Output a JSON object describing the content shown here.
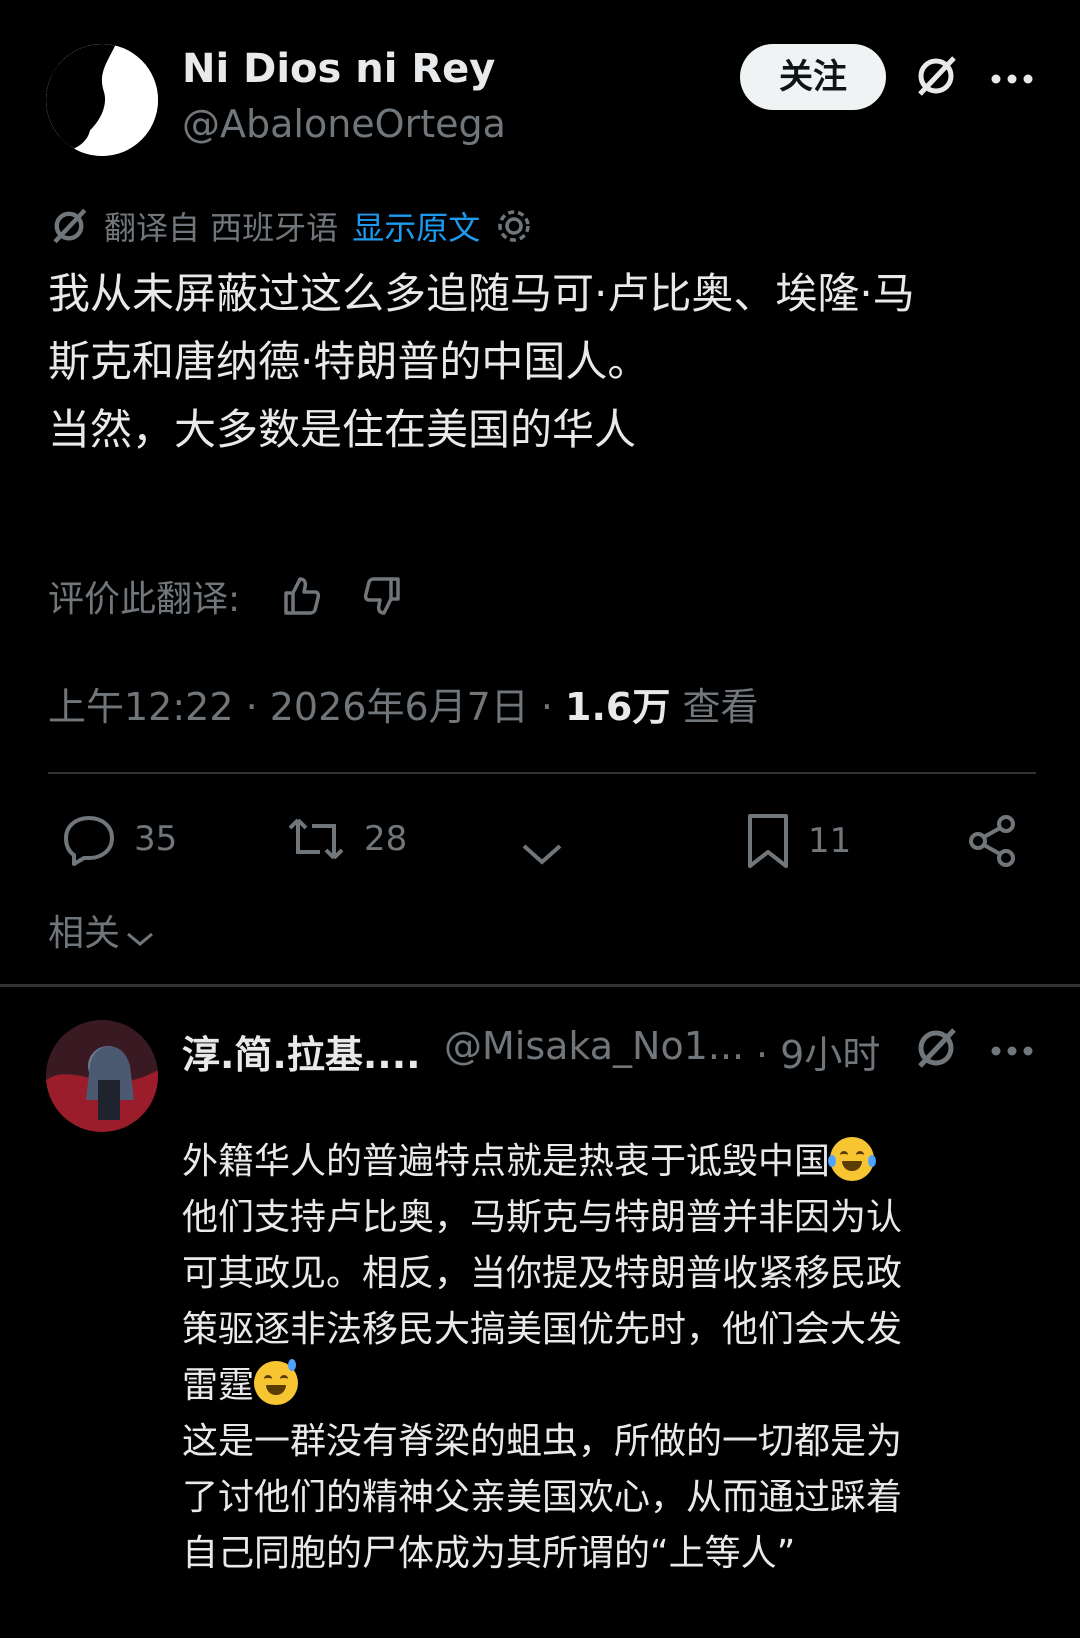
{
  "tweet": {
    "author_name": "Ni Dios ni Rey",
    "author_handle": "@AbaloneOrtega",
    "follow_label": "关注",
    "translation_source": "翻译自 西班牙语",
    "show_original": "显示原文",
    "text": "我从未屏蔽过这么多追随马可·卢比奥、埃隆·马\n斯克和唐纳德·特朗普的中国人。\n当然，大多数是住在美国的华人",
    "rate_label": "评价此翻译:",
    "timestamp": "上午12:22 · 2026年6月7日 · ",
    "views_count": "1.6万",
    "views_label": "查看",
    "replies": "35",
    "retweets": "28",
    "bookmarks": "11"
  },
  "related_label": "相关",
  "reply": {
    "author_name": "淳.简.拉基....",
    "author_handle": "@Misaka_No1...",
    "time": "· 9小时",
    "text_line1": "外籍华人的普遍特点就是热衷于诋毁中国",
    "text_block2": "他们支持卢比奥，马斯克与特朗普并非因为认\n可其政见。相反，当你提及特朗普收紧移民政\n策驱逐非法移民大搞美国优先时，他们会大发\n雷霆",
    "text_block3": "这是一群没有脊梁的蛆虫，所做的一切都是为\n了讨他们的精神父亲美国欢心，从而通过踩着\n自己同胞的尸体成为其所谓的“上等人”"
  }
}
